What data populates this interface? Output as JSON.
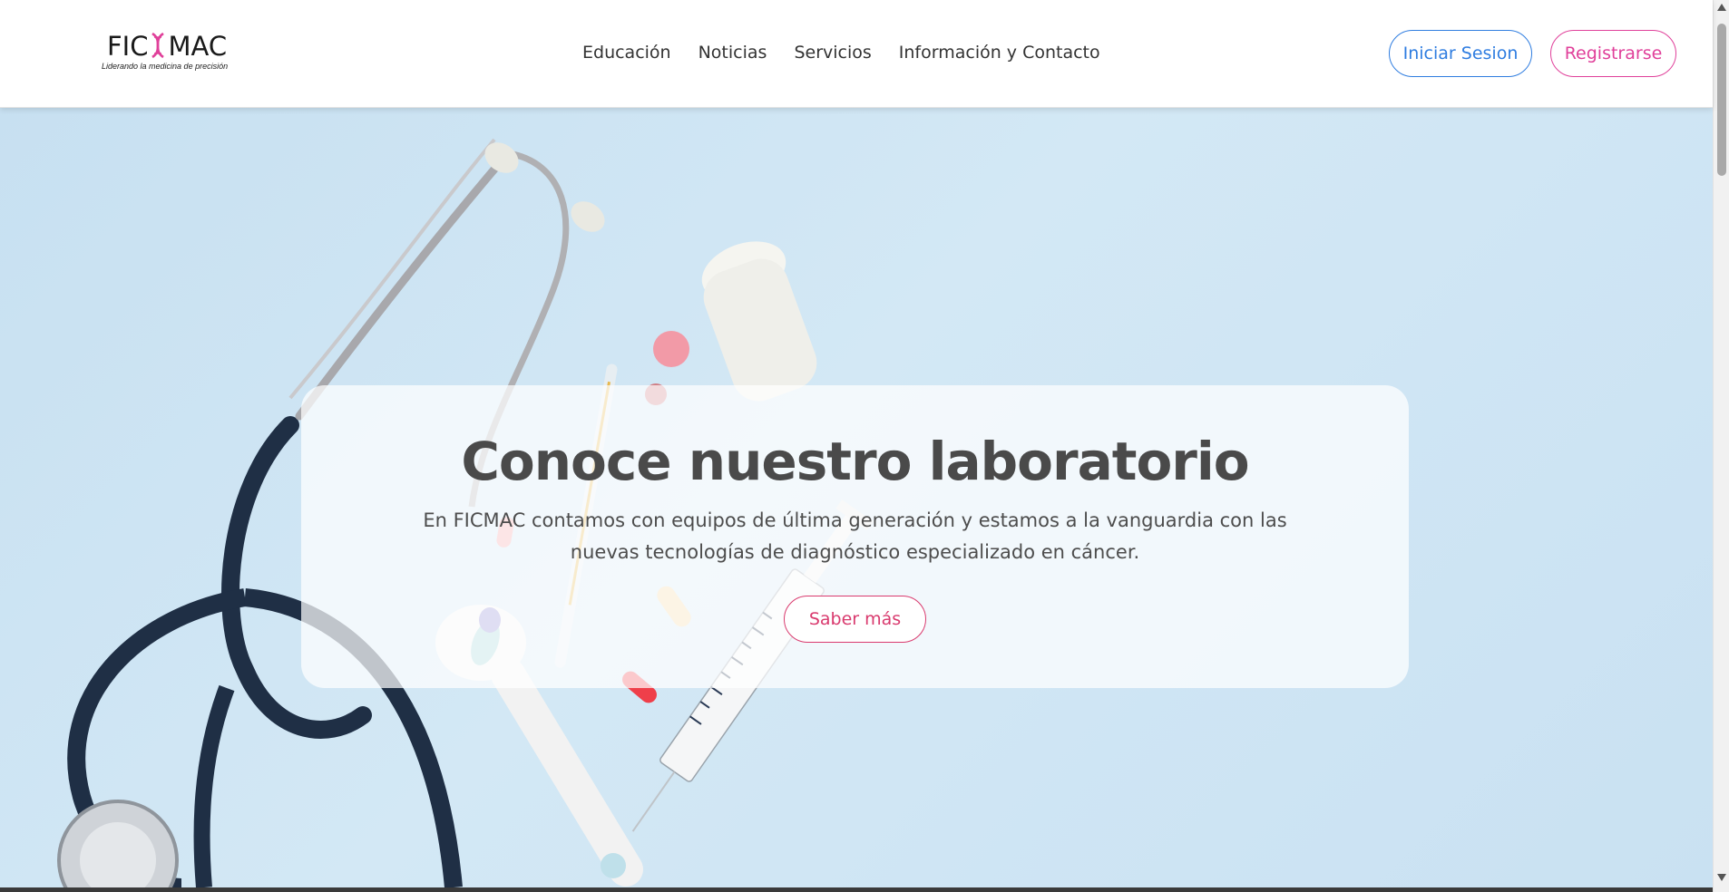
{
  "brand": {
    "name_left": "FIC",
    "name_right": "MAC",
    "tagline": "Liderando la medicina de precisión",
    "accent_color": "#e0409a"
  },
  "nav": {
    "items": [
      {
        "label": "Educación"
      },
      {
        "label": "Noticias"
      },
      {
        "label": "Servicios"
      },
      {
        "label": "Información y Contacto"
      }
    ]
  },
  "auth": {
    "login_label": "Iniciar Sesion",
    "login_color": "#2f7de0",
    "register_label": "Registrarse",
    "register_color": "#e0409a"
  },
  "hero": {
    "title": "Conoce nuestro laboratorio",
    "description": "En FICMAC contamos con equipos de última generación y estamos a la vanguardia con las nuevas tecnologías de diagnóstico especializado en cáncer.",
    "cta_label": "Saber más",
    "cta_color": "#d93a6e"
  }
}
